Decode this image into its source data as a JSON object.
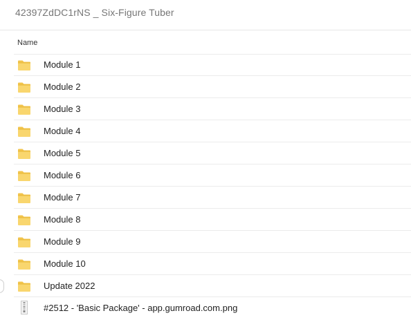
{
  "breadcrumb": "42397ZdDC1rNS _ Six-Figure Tuber",
  "columns": {
    "name": "Name"
  },
  "items": [
    {
      "type": "folder",
      "name": "Module 1"
    },
    {
      "type": "folder",
      "name": "Module 2"
    },
    {
      "type": "folder",
      "name": "Module 3"
    },
    {
      "type": "folder",
      "name": "Module 4"
    },
    {
      "type": "folder",
      "name": "Module 5"
    },
    {
      "type": "folder",
      "name": "Module 6"
    },
    {
      "type": "folder",
      "name": "Module 7"
    },
    {
      "type": "folder",
      "name": "Module 8"
    },
    {
      "type": "folder",
      "name": "Module 9"
    },
    {
      "type": "folder",
      "name": "Module 10"
    },
    {
      "type": "folder",
      "name": "Update 2022"
    },
    {
      "type": "file",
      "name": "#2512 - 'Basic Package' - app.gumroad.com.png"
    }
  ],
  "colors": {
    "folder_fill": "#f9d66e",
    "folder_tab": "#f2c44c",
    "divider": "#ebebeb",
    "text": "#222222",
    "breadcrumb_text": "#767676"
  },
  "icons": {
    "folder": "folder-icon",
    "file": "file-icon"
  }
}
